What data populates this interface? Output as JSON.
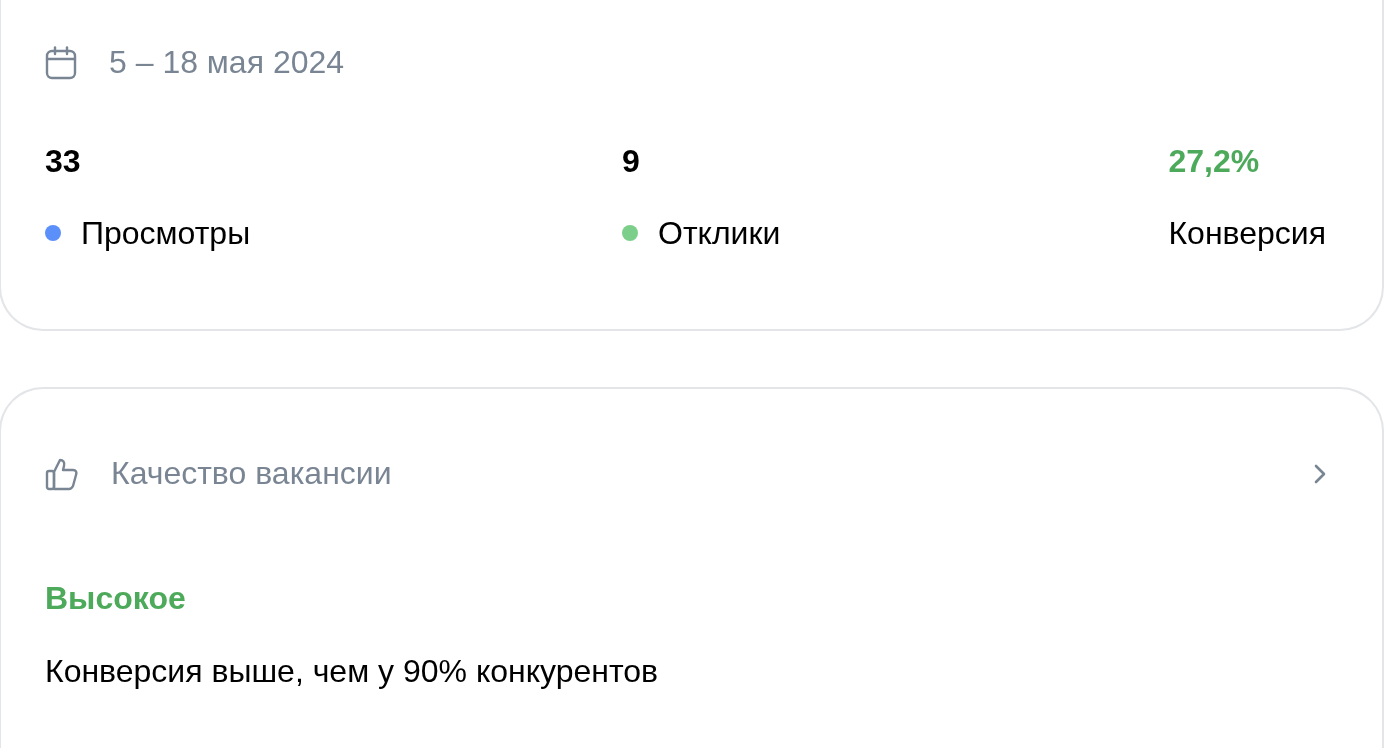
{
  "period": {
    "label": "5 – 18 мая 2024"
  },
  "metrics": [
    {
      "value": "33",
      "label": "Просмотры",
      "kind": "dot",
      "color": "#5b8ff9"
    },
    {
      "value": "9",
      "label": "Отклики",
      "kind": "dot",
      "color": "#7ccf8a"
    },
    {
      "value": "27,2%",
      "label": "Конверсия",
      "kind": "highlight"
    }
  ],
  "quality": {
    "title": "Качество вакансии",
    "rating": "Высокое",
    "description": "Конверсия выше, чем у 90% конкурентов"
  }
}
